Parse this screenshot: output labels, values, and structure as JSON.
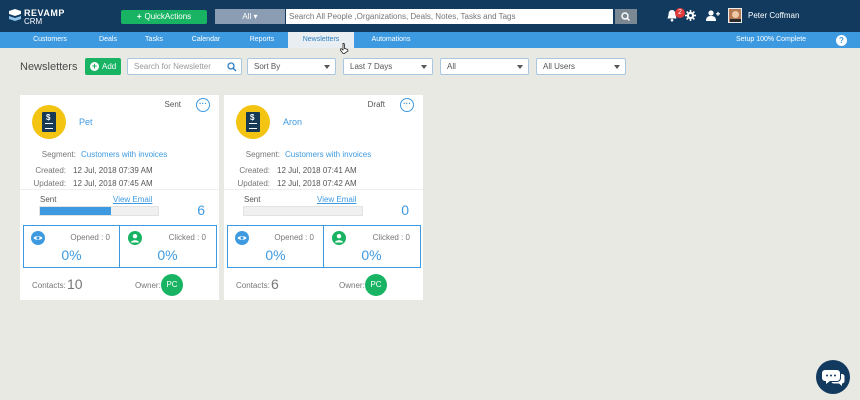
{
  "app": {
    "logo_line1": "REVAMP",
    "logo_line2": "CRM",
    "quick_actions": "QuickActions",
    "search_scope": "All",
    "search_placeholder": "Search All People ,Organizations, Deals, Notes, Tasks and Tags",
    "notification_count": "2",
    "user_name": "Peter Coffman"
  },
  "nav": {
    "items": [
      "Customers",
      "Deals",
      "Tasks",
      "Calendar",
      "Reports",
      "Newsletters",
      "Automations"
    ],
    "active": "Newsletters",
    "setup": "Setup 100% Complete",
    "help": "?"
  },
  "toolbar": {
    "title": "Newsletters",
    "add_label": "Add",
    "search_placeholder": "Search for Newsletter",
    "sort_by": "Sort By",
    "date_range": "Last 7 Days",
    "filter_all": "All",
    "users": "All Users"
  },
  "cards": [
    {
      "name": "Pet",
      "status": "Sent",
      "more": "···",
      "segment_label": "Segment:",
      "segment": "Customers with invoices",
      "created_label": "Created:",
      "created": "12 Jul, 2018 07:39 AM",
      "updated_label": "Updated:",
      "updated": "12 Jul, 2018 07:45 AM",
      "sent_label": "Sent",
      "view_email": "View Email",
      "sent_count": "6",
      "sent_progress": 0.6,
      "opened_label": "Opened : 0",
      "opened_pct": "0%",
      "clicked_label": "Clicked : 0",
      "clicked_pct": "0%",
      "contacts_label": "Contacts:",
      "contacts": "10",
      "owner_label": "Owner:",
      "owner_initials": "PC"
    },
    {
      "name": "Aron",
      "status": "Draft",
      "more": "···",
      "segment_label": "Segment:",
      "segment": "Customers with invoices",
      "created_label": "Created:",
      "created": "12 Jul, 2018 07:41 AM",
      "updated_label": "Updated:",
      "updated": "12 Jul, 2018 07:42 AM",
      "sent_label": "Sent",
      "view_email": "View Email",
      "sent_count": "0",
      "sent_progress": 0,
      "opened_label": "Opened : 0",
      "opened_pct": "0%",
      "clicked_label": "Clicked : 0",
      "clicked_pct": "0%",
      "contacts_label": "Contacts:",
      "contacts": "6",
      "owner_label": "Owner:",
      "owner_initials": "PC"
    }
  ],
  "colors": {
    "topbar": "#123a5e",
    "nav": "#3e9ae0",
    "accent_green": "#19b364",
    "accent_blue": "#3e9ae0",
    "newsletter_icon": "#f4c413"
  }
}
